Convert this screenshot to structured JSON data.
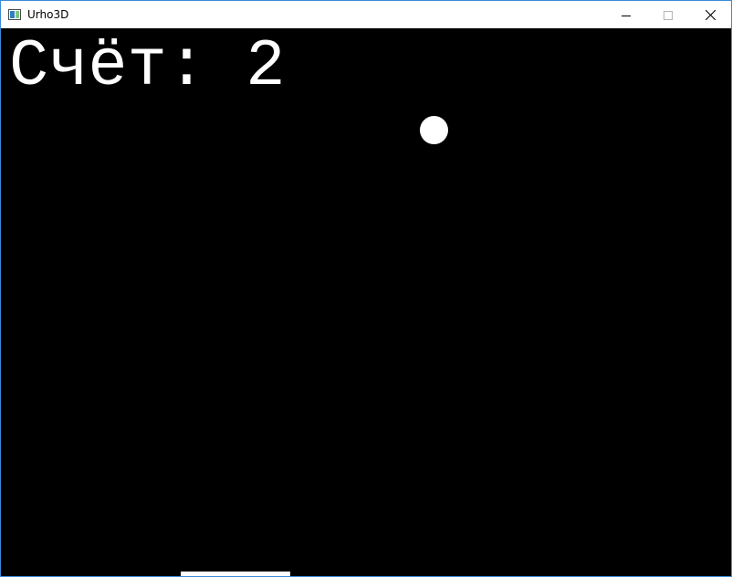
{
  "window": {
    "title": "Urho3D",
    "app_icon": "window-app-icon",
    "controls": {
      "minimize": "minimize-icon",
      "maximize": "maximize-icon",
      "close": "close-icon"
    },
    "border_color": "#3c8ad6"
  },
  "game": {
    "background": "#000000",
    "score_text": "Счёт: 2",
    "ball_color": "#ffffff",
    "paddle_color": "#ffffff"
  }
}
